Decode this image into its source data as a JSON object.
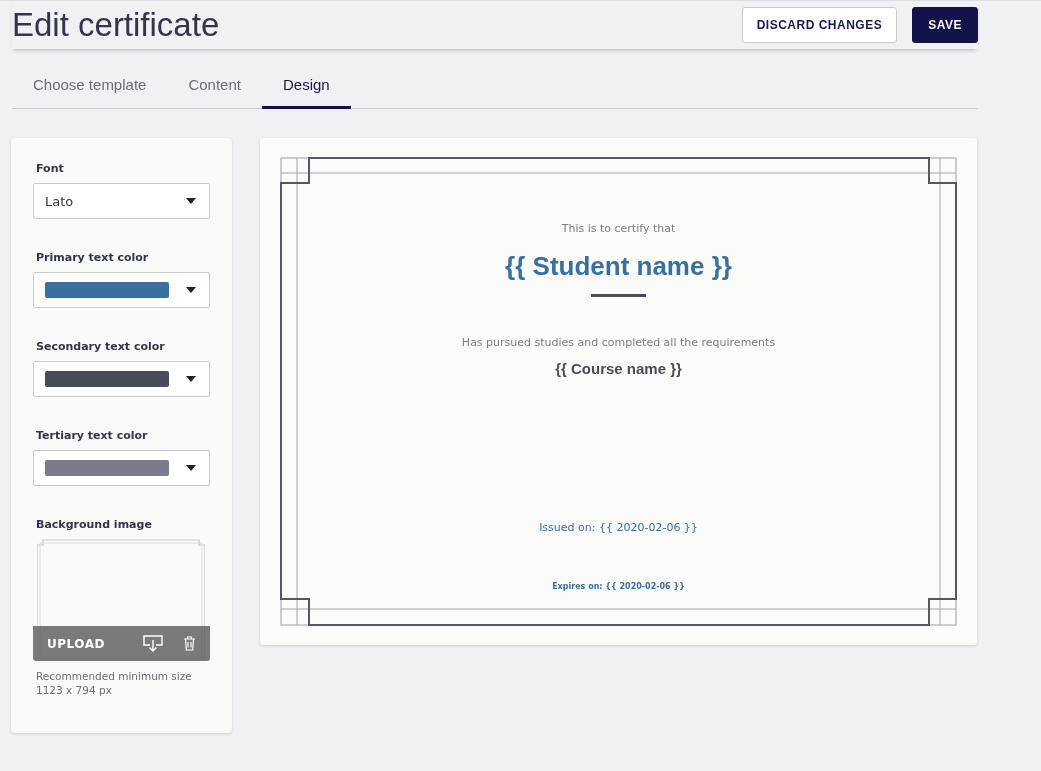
{
  "header": {
    "title": "Edit certificate",
    "buttons": [
      {
        "label": "DISCARD CHANGES",
        "kind": "secondary"
      },
      {
        "label": "SAVE",
        "kind": "primary"
      }
    ]
  },
  "tabs": [
    {
      "label": "Choose template",
      "selected": false
    },
    {
      "label": "Content",
      "selected": false
    },
    {
      "label": "Design",
      "selected": true
    }
  ],
  "design_panel": {
    "font": {
      "label": "Font",
      "value": "Lato"
    },
    "colors": [
      {
        "label": "Primary text color",
        "color": "#3870a0"
      },
      {
        "label": "Secondary text color",
        "color": "#4a4c5c"
      },
      {
        "label": "Tertiary text color",
        "color": "#7a7c8e"
      }
    ],
    "background_image": {
      "label": "Background image",
      "upload": "UPLOAD",
      "hint": [
        "Recommended minimum size",
        "1123 x 794 px"
      ]
    }
  },
  "certificate": {
    "lines": [
      {
        "kind": "tertiary",
        "text": "This is to certify that"
      },
      {
        "kind": "name",
        "text": "{{ Student name }}"
      },
      {
        "kind": "tertiary",
        "text": "Has pursued studies and completed all the requirements"
      },
      {
        "kind": "course",
        "text": "{{ Course name }}"
      },
      {
        "kind": "issued",
        "text": "Issued on: {{ 2020-02-06 }}"
      },
      {
        "kind": "expires",
        "text": "Expires on: {{ 2020-02-06 }}"
      }
    ]
  }
}
